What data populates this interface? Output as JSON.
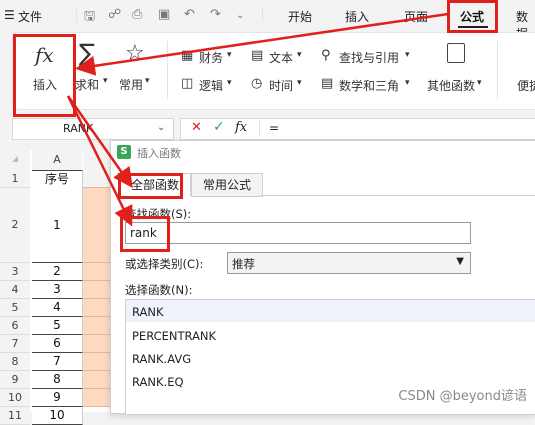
{
  "menubar": {
    "hamburger": "☰",
    "file": "文件",
    "tabs": [
      "开始",
      "插入",
      "页面",
      "公式",
      "数据"
    ],
    "active_tab": "公式"
  },
  "ribbon": {
    "insert_func_symbol": "fx",
    "insert_func_label": "插入",
    "sum_symbol": "∑",
    "sum_label": "求和",
    "common_label": "常用",
    "finance_label": "财务",
    "logic_label": "逻辑",
    "text_label": "文本",
    "time_label": "时间",
    "lookup_label": "查找与引用",
    "math_label": "数学和三角",
    "other_label": "其他函数",
    "convenient_label": "便捷"
  },
  "formula_bar": {
    "name_box": "RANK",
    "fx": "fx",
    "equals": "="
  },
  "grid": {
    "col_a": "A",
    "header_row": "1",
    "header_text": "序号",
    "rows": [
      {
        "num": "2",
        "val": "1"
      },
      {
        "num": "3",
        "val": "2"
      },
      {
        "num": "4",
        "val": "3"
      },
      {
        "num": "5",
        "val": "4"
      },
      {
        "num": "6",
        "val": "5"
      },
      {
        "num": "7",
        "val": "6"
      },
      {
        "num": "8",
        "val": "7"
      },
      {
        "num": "9",
        "val": "8"
      },
      {
        "num": "10",
        "val": "9"
      },
      {
        "num": "11",
        "val": "10"
      }
    ]
  },
  "dialog": {
    "logo": "S",
    "title": "插入函数",
    "tab_all": "全部函数",
    "tab_common": "常用公式",
    "search_label": "查找函数(S):",
    "search_value": "rank",
    "category_label": "或选择类别(C):",
    "category_value": "推荐",
    "select_label": "选择函数(N):",
    "functions": [
      "RANK",
      "PERCENTRANK",
      "RANK.AVG",
      "RANK.EQ"
    ]
  },
  "watermark": "CSDN @beyond谚语",
  "colors": {
    "annotation_red": "#e0201c",
    "fill_peach": "#fcd9bf",
    "brand_green": "#3ca55c"
  }
}
